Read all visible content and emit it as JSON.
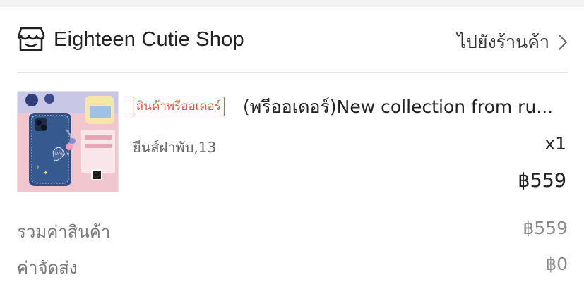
{
  "shop": {
    "name": "Eighteen Cutie Shop",
    "visit_label": "ไปยังร้านค้า",
    "icon": "shop-icon"
  },
  "product": {
    "badge": "สินค้าพรีออเดอร์",
    "title": "(พรีออเดอร์)New collection from ru...",
    "variant": "ยีนส์ฝาพับ,13",
    "quantity": "x1",
    "price": "฿559"
  },
  "summary": {
    "subtotal_label": "รวมค่าสินค้า",
    "subtotal_value": "฿559",
    "shipping_label": "ค่าจัดส่ง",
    "shipping_value": "฿0"
  },
  "colors": {
    "accent": "#e9573f",
    "divider": "#e6e6e6"
  }
}
